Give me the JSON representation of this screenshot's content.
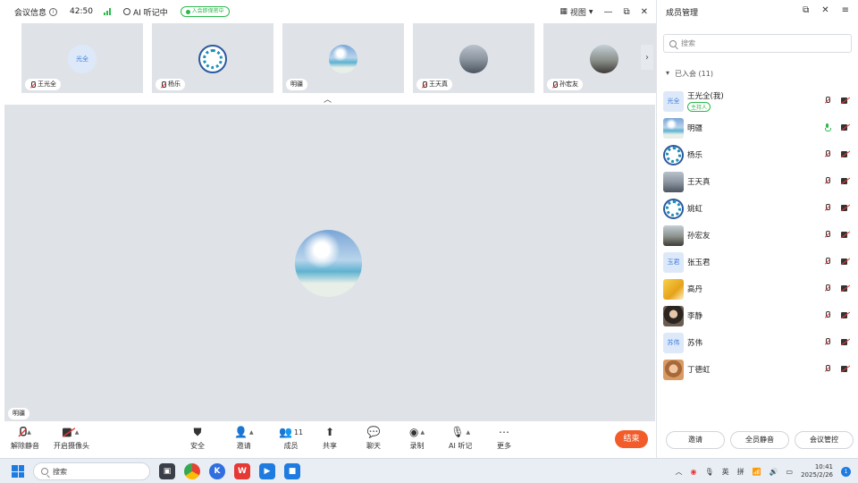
{
  "topbar": {
    "meeting_info": "会议信息",
    "timer": "42:50",
    "ai_status": "AI 听记中",
    "rec_badge": "入会即保密中",
    "view_label": "视图",
    "ctrl_min": "—",
    "ctrl_restore": "⧉",
    "ctrl_close": "✕"
  },
  "thumbnails": [
    {
      "name": "王光全",
      "avatar_text": "光全",
      "avatar": "text",
      "muted": true
    },
    {
      "name": "杨乐",
      "avatar": "emblem",
      "muted": true
    },
    {
      "name": "明疆",
      "avatar": "sea",
      "muted": false
    },
    {
      "name": "王天真",
      "avatar": "city",
      "muted": true
    },
    {
      "name": "孙宏友",
      "avatar": "street",
      "muted": true
    }
  ],
  "stage": {
    "speaker_name": "明疆"
  },
  "toolbar": {
    "unmute": "解除静音",
    "camera": "开启摄像头",
    "security": "安全",
    "invite": "邀请",
    "members": "成员",
    "members_count": "11",
    "share": "共享",
    "chat": "聊天",
    "record": "录制",
    "ai_notes": "AI 听记",
    "more": "更多",
    "leave": "结束"
  },
  "panel": {
    "title": "成员管理",
    "search_placeholder": "搜索",
    "group_label": "已入会 (11)",
    "members": [
      {
        "name": "王光全(我)",
        "badge": "主持人",
        "avatar": "text",
        "avatar_text": "光全",
        "mic": "off"
      },
      {
        "name": "明疆",
        "avatar": "sea",
        "mic": "on"
      },
      {
        "name": "杨乐",
        "avatar": "emblem",
        "mic": "off"
      },
      {
        "name": "王天真",
        "avatar": "city",
        "mic": "off"
      },
      {
        "name": "姚虹",
        "avatar": "emblem",
        "mic": "off"
      },
      {
        "name": "孙宏友",
        "avatar": "street",
        "mic": "off"
      },
      {
        "name": "张玉君",
        "avatar": "text",
        "avatar_text": "玉君",
        "mic": "off"
      },
      {
        "name": "高丹",
        "avatar": "yellow",
        "mic": "off"
      },
      {
        "name": "李静",
        "avatar": "portrait",
        "mic": "off"
      },
      {
        "name": "苏伟",
        "avatar": "text",
        "avatar_text": "苏伟",
        "mic": "off"
      },
      {
        "name": "丁德虹",
        "avatar": "child",
        "mic": "off"
      }
    ],
    "btn_invite": "邀请",
    "btn_mute_all": "全员静音",
    "btn_manage": "会议管控"
  },
  "taskbar": {
    "search": "搜索",
    "ime1": "英",
    "ime2": "拼",
    "time": "10:41",
    "date": "2025/2/26",
    "notif": "1"
  },
  "colors": {
    "accent": "#1e7be0",
    "green": "#2db84d",
    "leave": "#f25c2b",
    "stage": "#dfe3e8"
  }
}
